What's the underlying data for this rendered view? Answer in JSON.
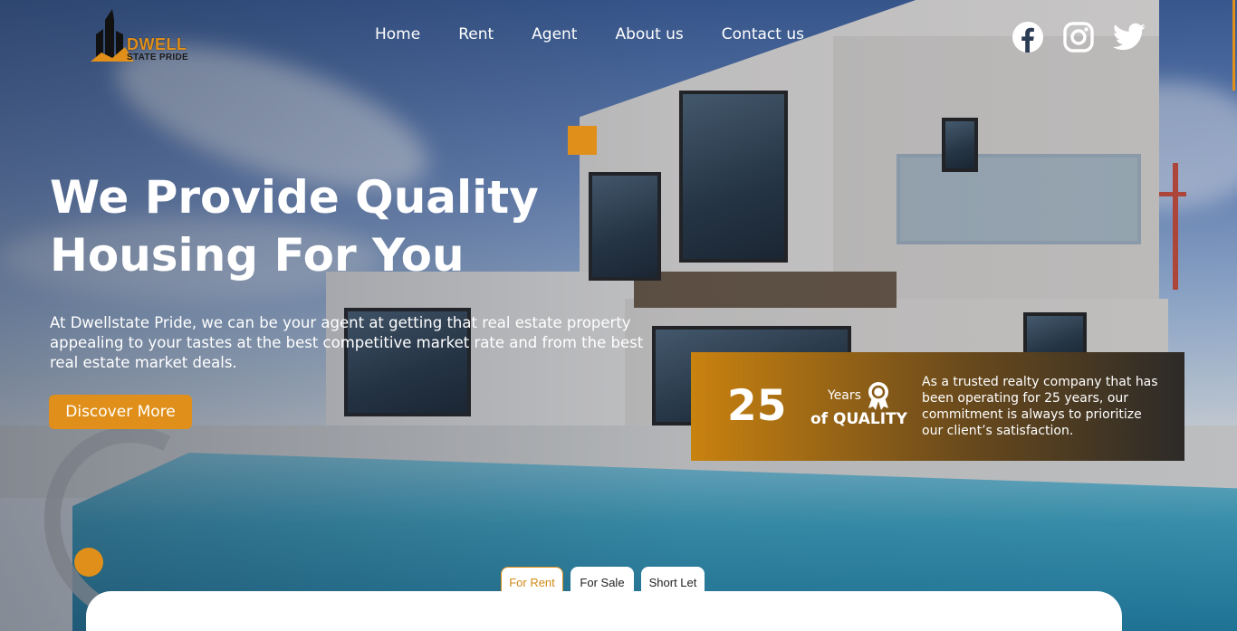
{
  "brand": {
    "word": "DWELL",
    "subline": "STATE PRIDE",
    "colors": {
      "accent": "#e0901a",
      "white": "#ffffff"
    }
  },
  "nav": {
    "items": [
      {
        "label": "Home"
      },
      {
        "label": "Rent"
      },
      {
        "label": "Agent"
      },
      {
        "label": "About us"
      },
      {
        "label": "Contact us"
      }
    ]
  },
  "social": {
    "icons": [
      "facebook-icon",
      "instagram-icon",
      "twitter-icon"
    ]
  },
  "hero": {
    "headline": "We Provide Quality Housing For You",
    "subtext": "At Dwellstate Pride, we can be your agent at getting that real estate property appealing to your tastes at the best competitive market rate and from the best real estate market deals.",
    "cta_label": "Discover More"
  },
  "stats": {
    "number": "25",
    "years_label": "Years",
    "quality_label": "of QUALITY",
    "award_icon": "award-ribbon-icon",
    "description": "As a trusted realty company that has been operating for 25 years, our commitment is always to prioritize our client’s satisfaction."
  },
  "search": {
    "tabs": [
      {
        "label": "For Rent",
        "active": true
      },
      {
        "label": "For Sale",
        "active": false
      },
      {
        "label": "Short Let",
        "active": false
      }
    ]
  }
}
